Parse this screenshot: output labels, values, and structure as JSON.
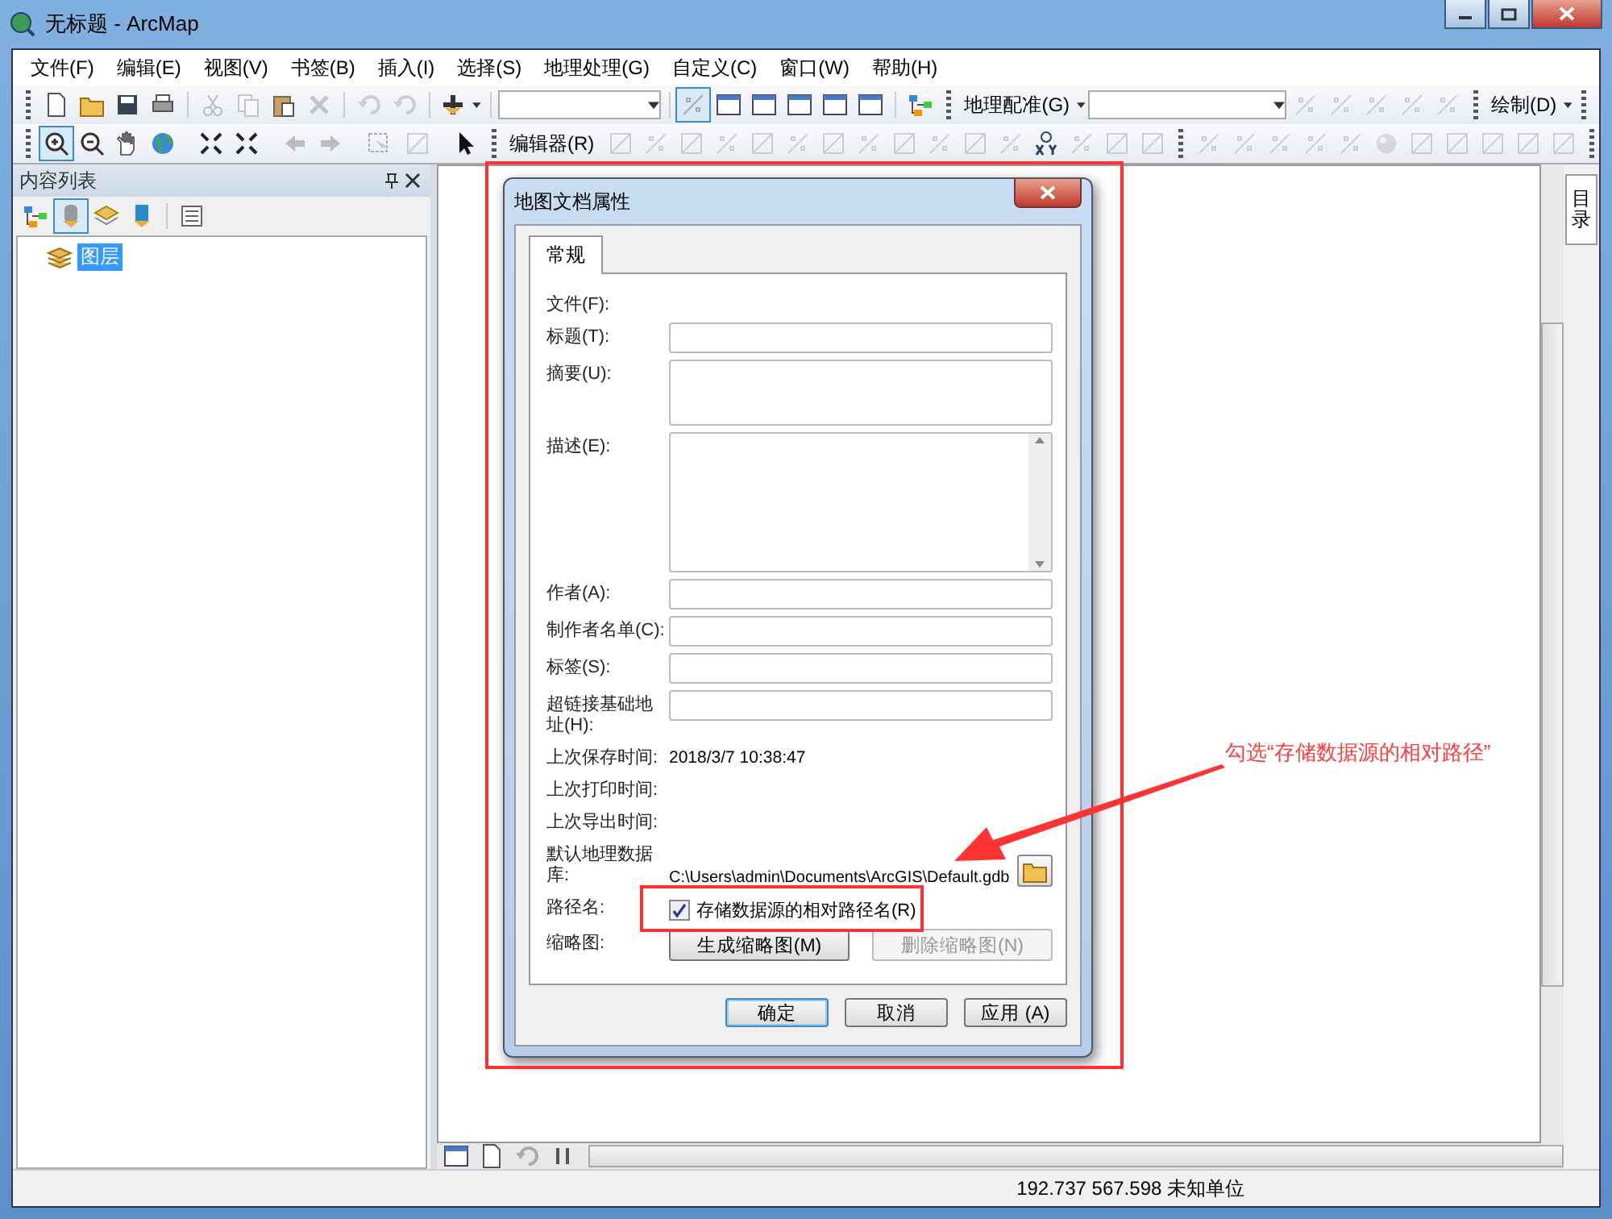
{
  "window": {
    "title": "无标题 - ArcMap"
  },
  "menu": [
    "文件(F)",
    "编辑(E)",
    "视图(V)",
    "书签(B)",
    "插入(I)",
    "选择(S)",
    "地理处理(G)",
    "自定义(C)",
    "窗口(W)",
    "帮助(H)"
  ],
  "toolbars": {
    "georeferencing": "地理配准(G)",
    "drawing": "绘制(D)",
    "editor": "编辑器(R)"
  },
  "toc": {
    "title": "内容列表",
    "layers": [
      {
        "label": "图层",
        "selected": true
      }
    ]
  },
  "side_tab": "目录",
  "dialog": {
    "title": "地图文档属性",
    "tabs": [
      {
        "label": "常规",
        "selected": true
      }
    ],
    "rows": [
      {
        "kind": "static",
        "label": "文件(F):"
      },
      {
        "kind": "text",
        "label": "标题(T):"
      },
      {
        "kind": "area",
        "label": "摘要(U):"
      },
      {
        "kind": "scrollarea",
        "label": "描述(E):"
      },
      {
        "kind": "text",
        "label": "作者(A):"
      },
      {
        "kind": "text",
        "label": "制作者名单(C):"
      },
      {
        "kind": "text",
        "label": "标签(S):"
      },
      {
        "kind": "text",
        "label": "超链接基础地址(H):"
      },
      {
        "kind": "value",
        "label": "上次保存时间:",
        "value": "2018/3/7 10:38:47"
      },
      {
        "kind": "static",
        "label": "上次打印时间:"
      },
      {
        "kind": "static",
        "label": "上次导出时间:"
      },
      {
        "kind": "path",
        "label": "默认地理数据库:",
        "value": "C:\\Users\\admin\\Documents\\ArcGIS\\Default.gdb"
      },
      {
        "kind": "checkbox",
        "label": "路径名:",
        "text": "存储数据源的相对路径名(R)",
        "checked": true
      },
      {
        "kind": "buttons",
        "label": "缩略图:",
        "buttons": [
          {
            "label": "生成缩略图(M)",
            "disabled": false
          },
          {
            "label": "删除缩略图(N)",
            "disabled": true
          }
        ]
      }
    ],
    "buttons": [
      {
        "label": "确定",
        "default": true
      },
      {
        "label": "取消",
        "default": false
      },
      {
        "label": "应用 (A)",
        "default": false
      }
    ]
  },
  "annotation": "勾选“存储数据源的相对路径”",
  "status_bar": {
    "coordinates": "192.737  567.598 未知单位"
  }
}
